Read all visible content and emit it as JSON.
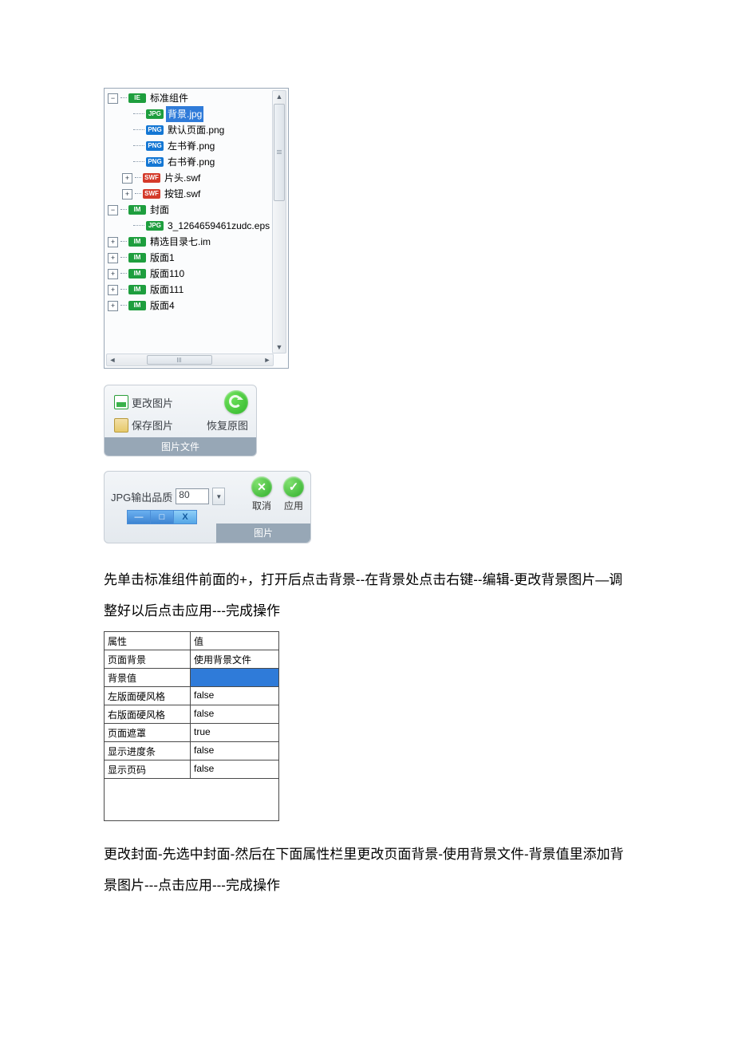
{
  "tree": {
    "root1": {
      "label": "标准组件",
      "badge": "IE",
      "expander": "−"
    },
    "children1": [
      {
        "label": "背景.jpg",
        "badge": "JPG",
        "selected": true
      },
      {
        "label": "默认页面.png",
        "badge": "PNG"
      },
      {
        "label": "左书脊.png",
        "badge": "PNG"
      },
      {
        "label": "右书脊.png",
        "badge": "PNG"
      },
      {
        "label": "片头.swf",
        "badge": "SWF",
        "expander": "+"
      },
      {
        "label": "按钮.swf",
        "badge": "SWF",
        "expander": "+"
      }
    ],
    "root2": {
      "label": "封面",
      "badge": "IM",
      "expander": "−"
    },
    "children2": [
      {
        "label": "3_1264659461zudc.eps",
        "badge": "JPG"
      }
    ],
    "rest": [
      {
        "label": "精选目录七.im",
        "badge": "IM",
        "expander": "+"
      },
      {
        "label": "版面1",
        "badge": "IM",
        "expander": "+"
      },
      {
        "label": "版面110",
        "badge": "IM",
        "expander": "+"
      },
      {
        "label": "版面111",
        "badge": "IM",
        "expander": "+"
      },
      {
        "label": "版面4",
        "badge": "IM",
        "expander": "+"
      }
    ]
  },
  "image_panel": {
    "change": "更改图片",
    "save": "保存图片",
    "restore": "恢复原图",
    "footer": "图片文件"
  },
  "quality_panel": {
    "label": "JPG输出品质",
    "value": "80",
    "cancel": "取消",
    "apply": "应用",
    "footer": "图片"
  },
  "paragraph1": "先单击标准组件前面的+，打开后点击背景--在背景处点击右键--编辑-更改背景图片—调整好以后点击应用---完成操作",
  "properties": {
    "header_k": "属性",
    "header_v": "值",
    "rows": [
      {
        "k": "页面背景",
        "v": "使用背景文件"
      },
      {
        "k": "背景值",
        "v": "",
        "selected": true
      },
      {
        "k": "左版面硬风格",
        "v": "false"
      },
      {
        "k": "右版面硬风格",
        "v": "false"
      },
      {
        "k": "页面遮罩",
        "v": "true"
      },
      {
        "k": "显示进度条",
        "v": "false"
      },
      {
        "k": "显示页码",
        "v": "false"
      }
    ]
  },
  "paragraph2": "更改封面-先选中封面-然后在下面属性栏里更改页面背景-使用背景文件-背景值里添加背景图片---点击应用---完成操作"
}
